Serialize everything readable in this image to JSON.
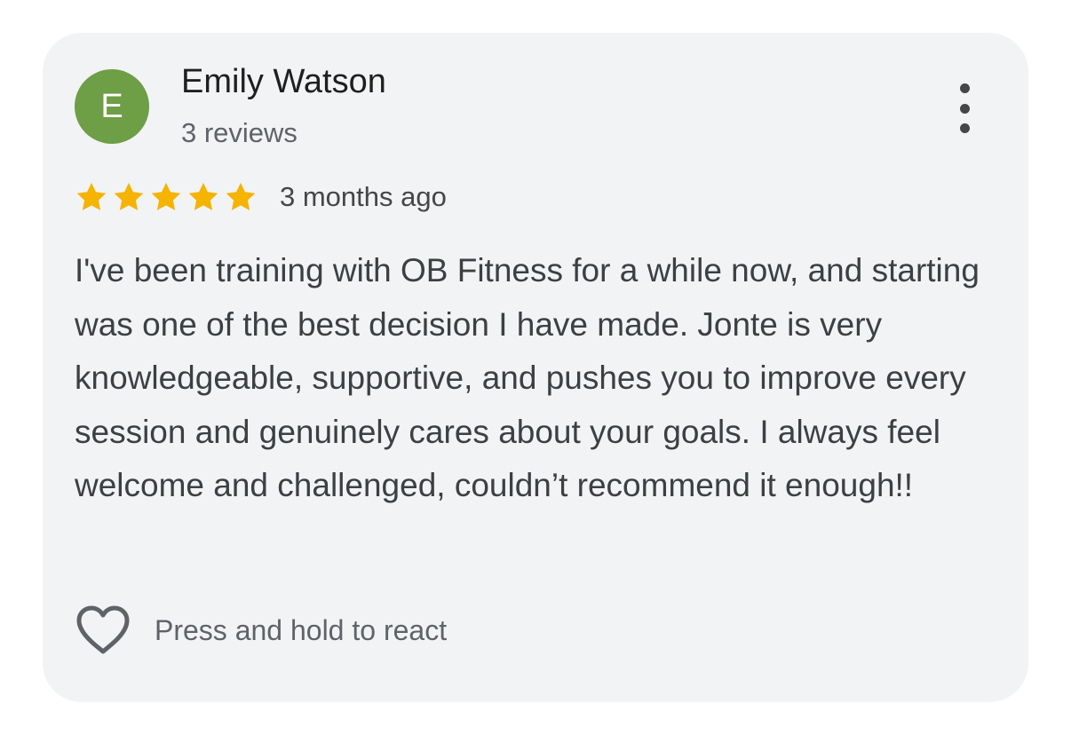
{
  "reviewer": {
    "avatar_letter": "E",
    "avatar_color": "#6e9e45",
    "name": "Emily Watson",
    "review_count": "3 reviews"
  },
  "menu": {
    "icon": "more-vert-icon"
  },
  "review": {
    "rating": 5,
    "rating_max": 5,
    "star_color": "#f4b400",
    "time": "3 months ago",
    "text": "I've been training with OB Fitness for a while now, and starting was one of the best decision I have made. Jonte is very knowledgeable, supportive, and pushes you to improve every session and genuinely cares about your goals. I always feel welcome and challenged, couldn’t recommend it enough!!"
  },
  "react": {
    "icon": "heart-outline-icon",
    "label": "Press and hold to react"
  }
}
